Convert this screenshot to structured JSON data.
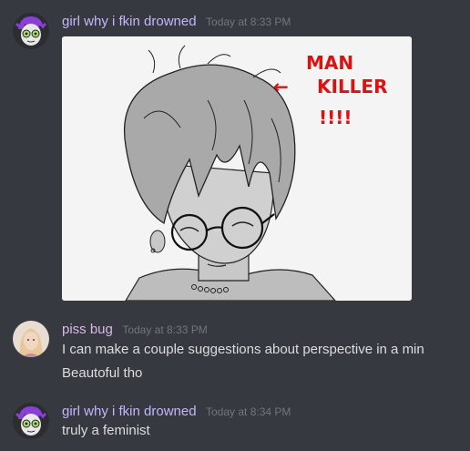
{
  "colors": {
    "background": "#36393f",
    "username_purple_user": "#c4b5fd",
    "username_pink_user": "#d9b8e9",
    "timestamp": "#72767d",
    "message_text": "#dcddde",
    "annotation_red": "#e01010"
  },
  "messages": [
    {
      "username": "girl why i fkin drowned",
      "timestamp": "Today at 8:33 PM",
      "avatar_icon": "purple-haired-character-avatar",
      "attachment": {
        "type": "image",
        "annotation_line1": "MAN",
        "annotation_arrow": "←",
        "annotation_line2": "KILLER",
        "annotation_line3": "!!!!"
      }
    },
    {
      "username": "piss bug",
      "timestamp": "Today at 8:33 PM",
      "avatar_icon": "blonde-user-avatar",
      "lines": [
        "I can make a couple suggestions about perspective in a min",
        "Beautoful tho"
      ]
    },
    {
      "username": "girl why i fkin drowned",
      "timestamp": "Today at 8:34 PM",
      "avatar_icon": "purple-haired-character-avatar",
      "lines": [
        "truly a feminist"
      ]
    }
  ]
}
